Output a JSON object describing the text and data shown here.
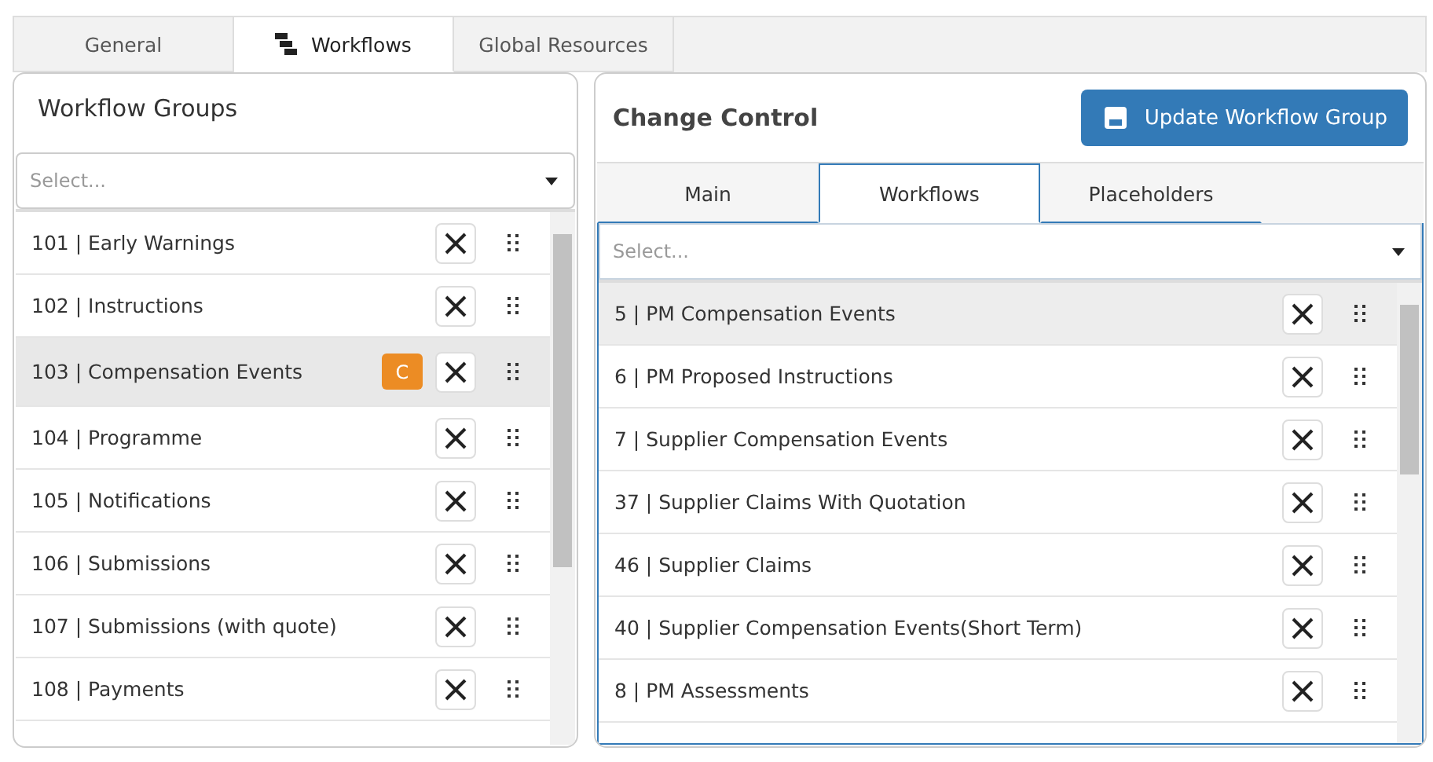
{
  "tabs": [
    {
      "label": "General",
      "selected": false,
      "icon": false
    },
    {
      "label": "Workflows",
      "selected": true,
      "icon": true
    },
    {
      "label": "Global Resources",
      "selected": false,
      "icon": false
    }
  ],
  "workflow_groups": {
    "title": "Workflow Groups",
    "select": {
      "placeholder": "Select..."
    },
    "items": [
      {
        "label": "101 | Early Warnings",
        "selected": false
      },
      {
        "label": "102 | Instructions",
        "selected": false
      },
      {
        "label": "103 | Compensation Events",
        "selected": true,
        "badge": "C"
      },
      {
        "label": "104 | Programme",
        "selected": false
      },
      {
        "label": "105 | Notifications",
        "selected": false
      },
      {
        "label": "106 | Submissions",
        "selected": false
      },
      {
        "label": "107 | Submissions (with quote)",
        "selected": false
      },
      {
        "label": "108 | Payments",
        "selected": false
      }
    ]
  },
  "detail": {
    "title": "Change Control",
    "button": "Update Workflow Group",
    "tabs": [
      {
        "label": "Main",
        "selected": false
      },
      {
        "label": "Workflows",
        "selected": true
      },
      {
        "label": "Placeholders",
        "selected": false
      }
    ],
    "select": {
      "placeholder": "Select..."
    },
    "items": [
      {
        "label": "5 | PM Compensation Events",
        "selected": true
      },
      {
        "label": "6 | PM Proposed Instructions",
        "selected": false
      },
      {
        "label": "7 | Supplier Compensation Events",
        "selected": false
      },
      {
        "label": "37 | Supplier Claims With Quotation",
        "selected": false
      },
      {
        "label": "46 | Supplier Claims",
        "selected": false
      },
      {
        "label": "40 | Supplier Compensation Events(Short Term)",
        "selected": false
      },
      {
        "label": "8 | PM Assessments",
        "selected": false
      }
    ]
  }
}
